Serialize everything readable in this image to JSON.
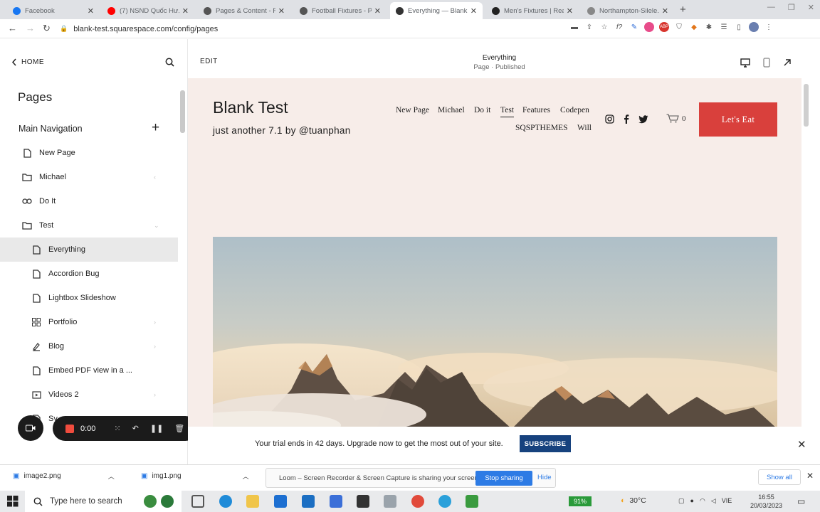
{
  "browser": {
    "tabs": [
      {
        "title": "Facebook",
        "color": "#1877f2",
        "active": false
      },
      {
        "title": "(7) NSND Quốc Hư...",
        "color": "#ff0000",
        "active": false
      },
      {
        "title": "Pages & Content - F...",
        "color": "#555555",
        "active": false
      },
      {
        "title": "Football Fixtures - P...",
        "color": "#555555",
        "active": false
      },
      {
        "title": "Everything — Blank...",
        "color": "#333333",
        "active": true
      },
      {
        "title": "Men's Fixtures | Real...",
        "color": "#222222",
        "active": false
      },
      {
        "title": "Northampton-Silele...",
        "color": "#888888",
        "active": false
      }
    ],
    "url": "blank-test.squarespace.com/config/pages"
  },
  "sidebar": {
    "home_label": "HOME",
    "title": "Pages",
    "section_label": "Main Navigation",
    "items": [
      {
        "label": "New Page",
        "icon": "page-icon",
        "indent": false,
        "selected": false,
        "chevron": ""
      },
      {
        "label": "Michael",
        "icon": "folder-icon",
        "indent": false,
        "selected": false,
        "chevron": "‹"
      },
      {
        "label": "Do It",
        "icon": "link-icon",
        "indent": false,
        "selected": false,
        "chevron": ""
      },
      {
        "label": "Test",
        "icon": "folder-icon",
        "indent": false,
        "selected": false,
        "chevron": "⌄"
      },
      {
        "label": "Everything",
        "icon": "page-icon",
        "indent": true,
        "selected": true,
        "chevron": ""
      },
      {
        "label": "Accordion Bug",
        "icon": "page-icon",
        "indent": true,
        "selected": false,
        "chevron": ""
      },
      {
        "label": "Lightbox Slideshow",
        "icon": "page-icon",
        "indent": true,
        "selected": false,
        "chevron": ""
      },
      {
        "label": "Portfolio",
        "icon": "grid-icon",
        "indent": true,
        "selected": false,
        "chevron": "›"
      },
      {
        "label": "Blog",
        "icon": "blog-icon",
        "indent": true,
        "selected": false,
        "chevron": "›"
      },
      {
        "label": "Embed PDF view in a ...",
        "icon": "page-icon",
        "indent": true,
        "selected": false,
        "chevron": ""
      },
      {
        "label": "Videos 2",
        "icon": "video-icon",
        "indent": true,
        "selected": false,
        "chevron": "›"
      },
      {
        "label": "Sy...",
        "icon": "page-icon",
        "indent": true,
        "selected": false,
        "chevron": ""
      }
    ]
  },
  "recorder": {
    "time": "0:00"
  },
  "editor": {
    "edit_label": "EDIT",
    "page_name": "Everything",
    "page_status": "Page · Published"
  },
  "site": {
    "title": "Blank Test",
    "tagline": "just another 7.1 by @tuanphan",
    "nav_row1": [
      "New Page",
      "Michael",
      "Do it",
      "Test",
      "Features",
      "Codepen"
    ],
    "nav_row2": [
      "SQSPTHEMES",
      "Will"
    ],
    "active_nav": "Test",
    "cart_count": "0",
    "cta_label": "Let's Eat",
    "accent_color": "#d9403c"
  },
  "trial": {
    "text": "Your trial ends in 42 days. Upgrade now to get the most out of your site.",
    "subscribe_label": "SUBSCRIBE"
  },
  "downloads": {
    "items": [
      "image2.png",
      "img1.png"
    ],
    "loom_text": "Loom – Screen Recorder & Screen Capture is sharing your screen.",
    "stop_label": "Stop sharing",
    "hide_label": "Hide",
    "show_all_label": "Show all"
  },
  "taskbar": {
    "search_placeholder": "Type here to search",
    "battery": "91%",
    "temperature": "30°C",
    "lang": "VIE",
    "time": "16:55",
    "date": "20/03/2023"
  }
}
